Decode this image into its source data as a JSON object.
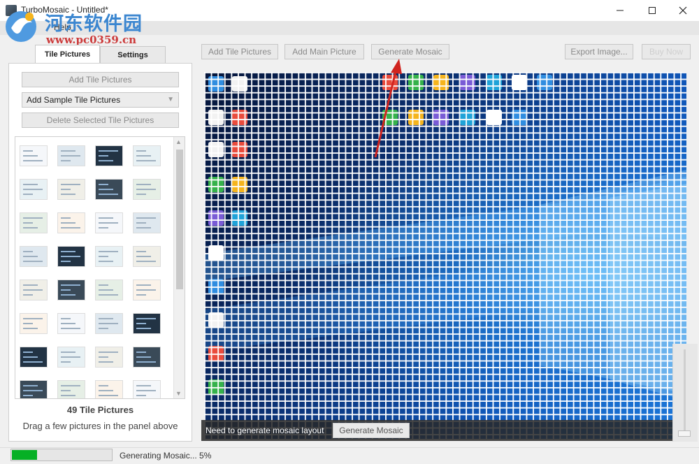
{
  "window": {
    "title": "TurboMosaic - Untitled*",
    "minimize_icon": "minimize-icon",
    "maximize_icon": "maximize-icon",
    "close_icon": "close-icon"
  },
  "watermark": {
    "name": "河东软件园",
    "url": "www.pc0359.cn"
  },
  "menu": {
    "help": "Help"
  },
  "tabs": [
    {
      "label": "Tile Pictures",
      "active": true
    },
    {
      "label": "Settings",
      "active": false
    }
  ],
  "left_panel": {
    "add_tile_pictures": "Add Tile Pictures",
    "add_sample_tile_pictures": "Add Sample Tile Pictures",
    "delete_selected_tile_pictures": "Delete Selected Tile Pictures",
    "tile_count": "49 Tile Pictures",
    "hint": "Drag a few pictures in the panel above"
  },
  "toolbar": {
    "add_tile_pictures": "Add Tile Pictures",
    "add_main_picture": "Add Main Picture",
    "generate_mosaic": "Generate Mosaic",
    "export_image": "Export Image...",
    "buy_now": "Buy Now"
  },
  "canvas": {
    "message": "Need to generate mosaic layout",
    "generate_button": "Generate Mosaic"
  },
  "status": {
    "text": "Generating Mosaic... 5%",
    "progress": 0.25
  },
  "colors": {
    "progress_fill": "#06b025",
    "annotation_arrow": "#d0241f",
    "watermark_blue": "#3b86d0",
    "watermark_red": "#cc3a3a"
  }
}
